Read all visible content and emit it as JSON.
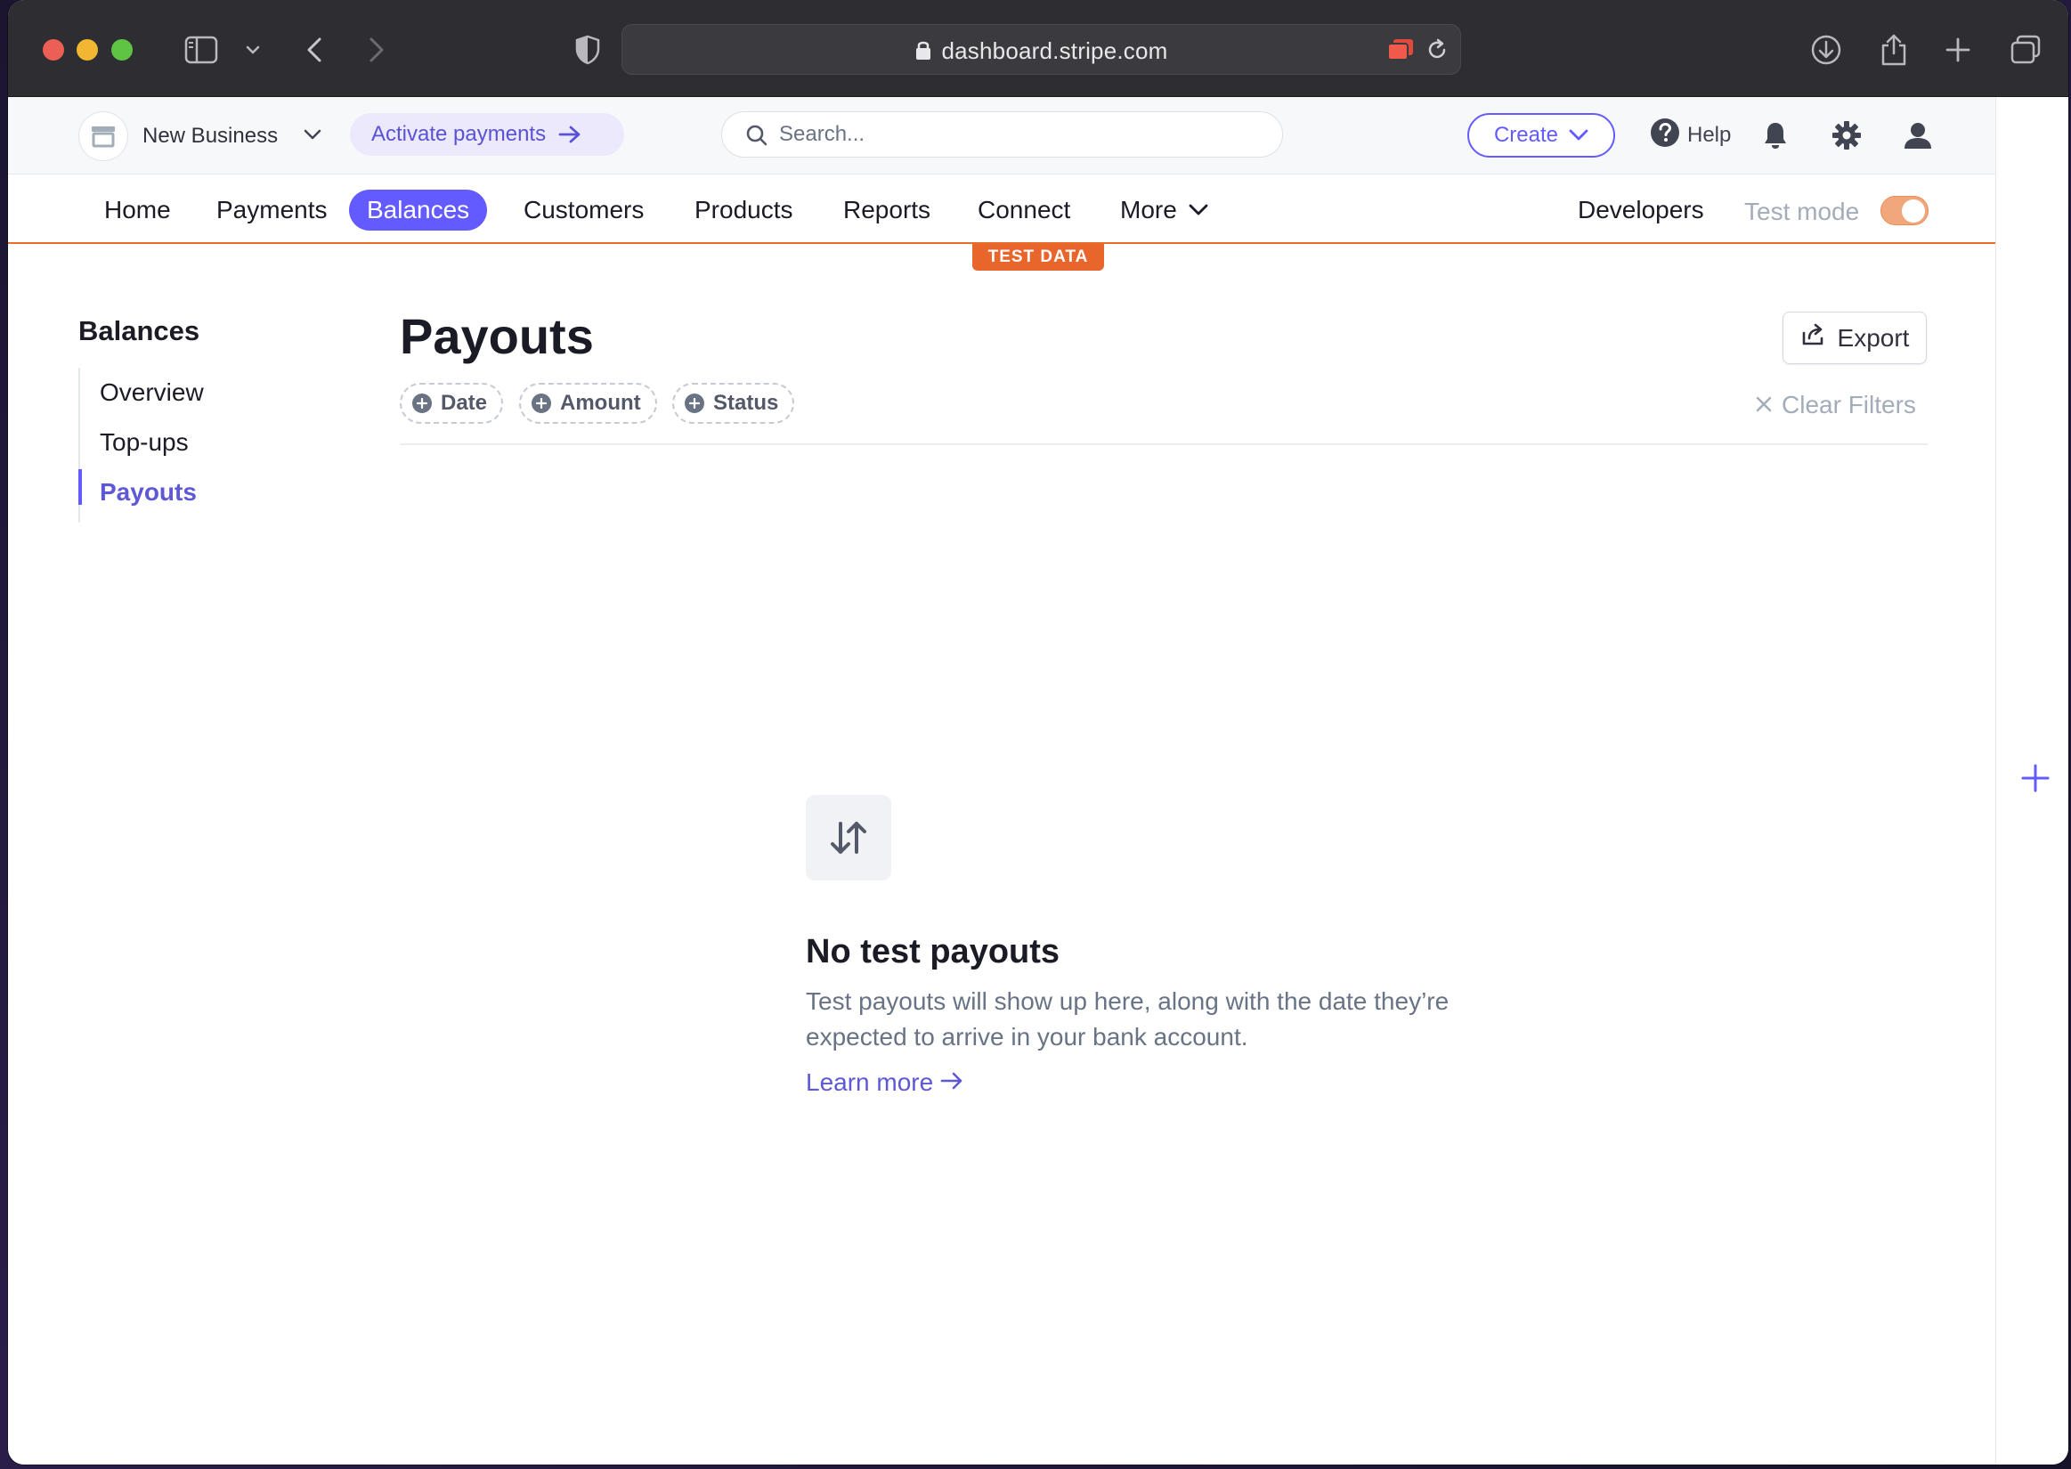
{
  "browser": {
    "url": "dashboard.stripe.com"
  },
  "header": {
    "business_name": "New Business",
    "activate_label": "Activate payments",
    "search_placeholder": "Search...",
    "create_label": "Create",
    "help_label": "Help"
  },
  "nav": {
    "items": [
      {
        "label": "Home"
      },
      {
        "label": "Payments"
      },
      {
        "label": "Balances",
        "active": true
      },
      {
        "label": "Customers"
      },
      {
        "label": "Products"
      },
      {
        "label": "Reports"
      },
      {
        "label": "Connect"
      },
      {
        "label": "More"
      }
    ],
    "developers_label": "Developers",
    "test_mode_label": "Test mode",
    "test_mode_on": true,
    "test_badge": "TEST DATA"
  },
  "sidebar": {
    "title": "Balances",
    "items": [
      {
        "label": "Overview"
      },
      {
        "label": "Top-ups"
      },
      {
        "label": "Payouts",
        "active": true
      }
    ]
  },
  "main": {
    "title": "Payouts",
    "export_label": "Export",
    "filters": [
      {
        "label": "Date"
      },
      {
        "label": "Amount"
      },
      {
        "label": "Status"
      }
    ],
    "clear_filters_label": "Clear Filters"
  },
  "empty_state": {
    "title": "No test payouts",
    "description": "Test payouts will show up here, along with the date they’re expected to arrive in your bank account.",
    "link_label": "Learn more"
  },
  "colors": {
    "accent": "#635bff",
    "test_mode": "#e8652b"
  },
  "icons": [
    "sidebar-toggle-icon",
    "chevron-down-icon",
    "back-icon",
    "forward-icon",
    "shield-icon",
    "lock-icon",
    "tab-group-icon",
    "reload-icon",
    "download-icon",
    "share-icon",
    "new-tab-icon",
    "tabs-overview-icon",
    "store-icon",
    "arrow-right-icon",
    "search-icon",
    "help-icon",
    "bell-icon",
    "gear-icon",
    "user-icon",
    "export-icon",
    "plus-circle-icon",
    "close-icon",
    "transfer-arrows-icon",
    "plus-icon"
  ]
}
